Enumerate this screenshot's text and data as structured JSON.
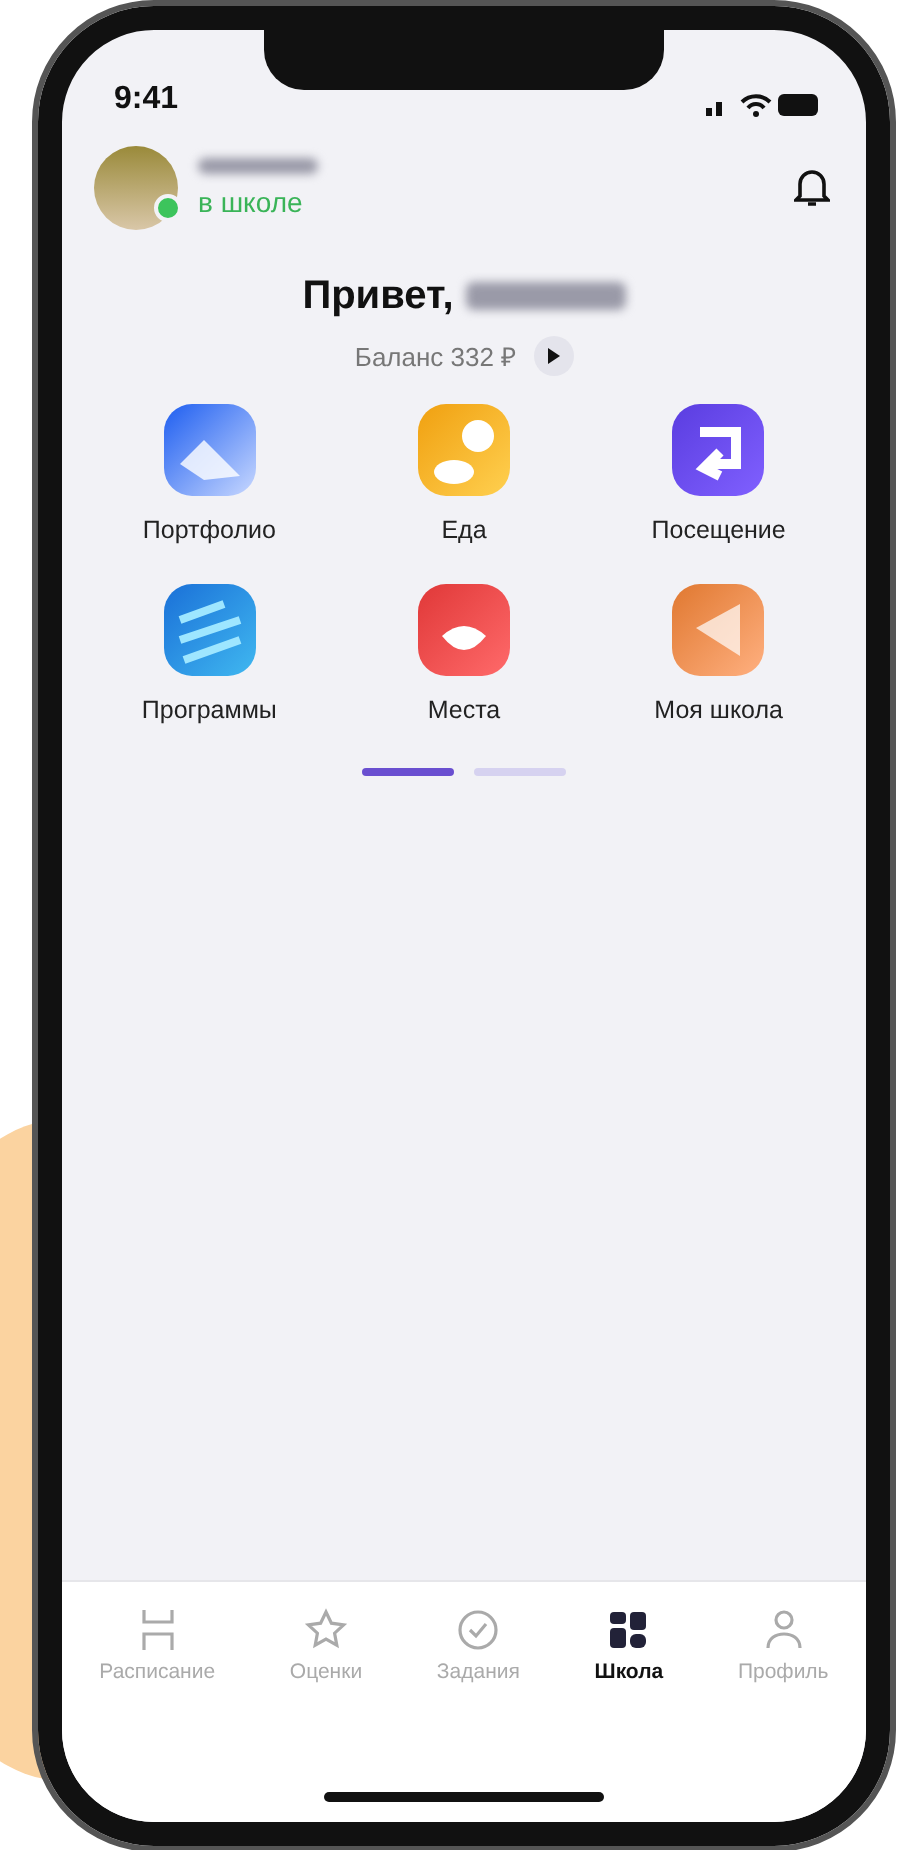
{
  "status_bar": {
    "time": "9:41"
  },
  "user": {
    "status": "в школе",
    "online": true
  },
  "greeting": "Привет,",
  "balance": "Баланс 332 ₽",
  "apps": [
    {
      "label": "Портфолио",
      "kind": "portfolio"
    },
    {
      "label": "Еда",
      "kind": "food"
    },
    {
      "label": "Посещение",
      "kind": "attendance"
    },
    {
      "label": "Программы",
      "kind": "programs"
    },
    {
      "label": "Места",
      "kind": "places"
    },
    {
      "label": "Моя школа",
      "kind": "school"
    }
  ],
  "pager": [
    {
      "selected": true
    },
    {
      "selected": false
    }
  ],
  "tabs": [
    {
      "label": "Расписание",
      "kind": "schedule",
      "selected": false
    },
    {
      "label": "Оценки",
      "kind": "grades",
      "selected": false
    },
    {
      "label": "Задания",
      "kind": "tasks",
      "selected": false
    },
    {
      "label": "Школа",
      "kind": "school",
      "selected": true
    },
    {
      "label": "Профиль",
      "kind": "profile",
      "selected": false
    }
  ]
}
